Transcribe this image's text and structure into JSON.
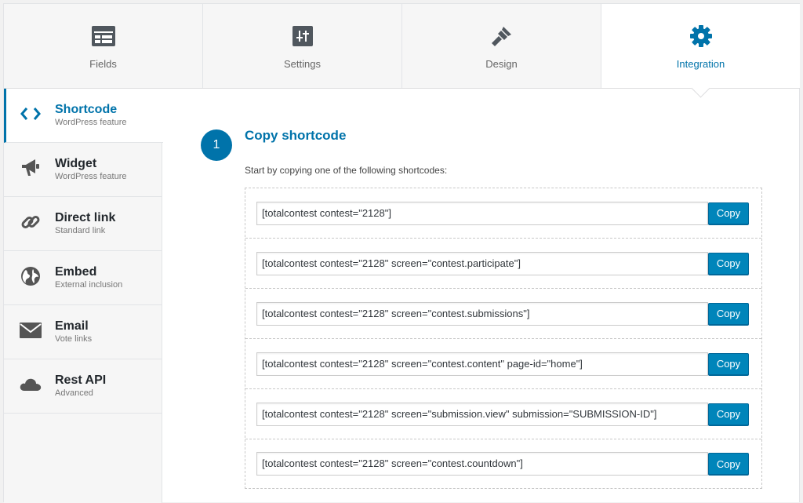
{
  "tabs": [
    {
      "label": "Fields",
      "icon": "fields-icon"
    },
    {
      "label": "Settings",
      "icon": "sliders-icon"
    },
    {
      "label": "Design",
      "icon": "brush-icon"
    },
    {
      "label": "Integration",
      "icon": "gear-icon"
    }
  ],
  "active_tab": "Integration",
  "sidebar": {
    "items": [
      {
        "title": "Shortcode",
        "sub": "WordPress feature",
        "icon": "code-icon"
      },
      {
        "title": "Widget",
        "sub": "WordPress feature",
        "icon": "megaphone-icon"
      },
      {
        "title": "Direct link",
        "sub": "Standard link",
        "icon": "link-icon"
      },
      {
        "title": "Embed",
        "sub": "External inclusion",
        "icon": "globe-icon"
      },
      {
        "title": "Email",
        "sub": "Vote links",
        "icon": "envelope-icon"
      },
      {
        "title": "Rest API",
        "sub": "Advanced",
        "icon": "cloud-icon"
      }
    ]
  },
  "step": {
    "number": "1",
    "title": "Copy shortcode",
    "description": "Start by copying one of the following shortcodes:"
  },
  "shortcodes": [
    "[totalcontest contest=\"2128\"]",
    "[totalcontest contest=\"2128\" screen=\"contest.participate\"]",
    "[totalcontest contest=\"2128\" screen=\"contest.submissions\"]",
    "[totalcontest contest=\"2128\" screen=\"contest.content\" page-id=\"home\"]",
    "[totalcontest contest=\"2128\" screen=\"submission.view\" submission=\"SUBMISSION-ID\"]",
    "[totalcontest contest=\"2128\" screen=\"contest.countdown\"]"
  ],
  "copy_label": "Copy",
  "colors": {
    "accent": "#0073aa",
    "button": "#0085ba"
  }
}
